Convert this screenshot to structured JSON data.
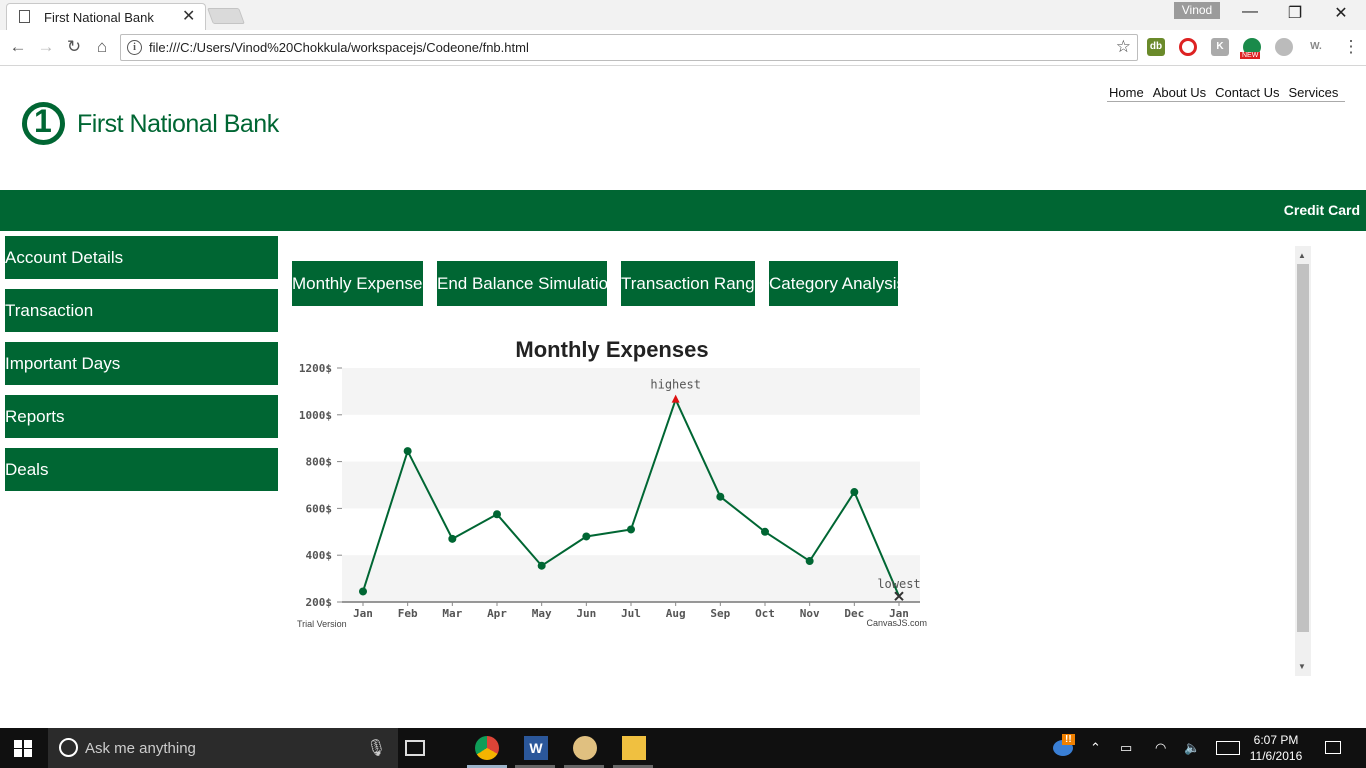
{
  "browser": {
    "tab_title": "First National Bank",
    "tab_close": "✕",
    "profile": "Vinod",
    "min": "—",
    "restore": "❐",
    "close": "✕",
    "back": "←",
    "forward": "→",
    "reload": "↻",
    "home": "⌂",
    "info": "i",
    "url": "file:///C:/Users/Vinod%20Chokkula/workspacejs/Codeone/fnb.html",
    "star": "☆",
    "menu": "⋮",
    "ext_new": "NEW"
  },
  "header": {
    "logo_text": "First National Bank",
    "nav": [
      "Home",
      "About Us",
      "Contact Us",
      "Services"
    ]
  },
  "banner": {
    "label": "Credit Card"
  },
  "sidebar": {
    "items": [
      "Account Details",
      "Transaction",
      "Important Days",
      "Reports",
      "Deals"
    ]
  },
  "tabs": [
    "Monthly Expenses",
    "End Balance Simulation",
    "Transaction Range",
    "Category Analysis"
  ],
  "chart_data": {
    "type": "line",
    "title": "Monthly Expenses",
    "categories": [
      "Jan",
      "Feb",
      "Mar",
      "Apr",
      "May",
      "Jun",
      "Jul",
      "Aug",
      "Sep",
      "Oct",
      "Nov",
      "Dec",
      "Jan"
    ],
    "values": [
      245,
      845,
      470,
      575,
      355,
      480,
      510,
      1065,
      650,
      500,
      375,
      670,
      225
    ],
    "ylim": [
      200,
      1200
    ],
    "y_ticks": [
      200,
      400,
      600,
      800,
      1000,
      1200
    ],
    "y_suffix": "$",
    "annotations": [
      {
        "index": 7,
        "label": "highest",
        "marker": "triangle"
      },
      {
        "index": 12,
        "label": "lowest",
        "marker": "cross"
      }
    ],
    "credit_left": "Trial Version",
    "credit_right": "CanvasJS.com",
    "colors": {
      "line": "#006633",
      "highest": "#dd1111",
      "lowest": "#333333",
      "band": "#f4f4f4"
    }
  },
  "taskbar": {
    "search_placeholder": "Ask me anything",
    "time": "6:07 PM",
    "date": "11/6/2016"
  }
}
